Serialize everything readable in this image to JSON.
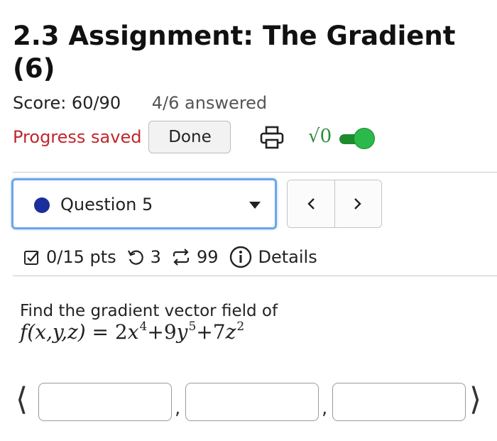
{
  "header": {
    "title": "2.3 Assignment: The Gradient (6)",
    "score": "Score: 60/90",
    "answered": "4/6 answered",
    "progress_status": "Progress saved",
    "done_label": "Done",
    "print_icon": "printer-icon",
    "math_toggle": {
      "icon": "sqrt-zero-icon",
      "glyph": "√0",
      "state": "on",
      "color": "#2ab94a"
    }
  },
  "question_nav": {
    "selected": "Question 5",
    "status_color": "#1a2f9c",
    "prev_label": "<",
    "next_label": ">"
  },
  "question_meta": {
    "points": "0/15 pts",
    "retries": "3",
    "attempts": "99",
    "details_label": "Details"
  },
  "problem": {
    "prompt": "Find the gradient vector field of",
    "formula": {
      "lhs": "f(x,y,z) = ",
      "terms": [
        {
          "coef": "2",
          "var": "x",
          "exp": "4",
          "op": "+"
        },
        {
          "coef": "9",
          "var": "y",
          "exp": "5",
          "op": "+"
        },
        {
          "coef": "7",
          "var": "z",
          "exp": "2",
          "op": ""
        }
      ]
    },
    "answer": {
      "open_bracket": "⟨",
      "close_bracket": "⟩",
      "separator": ",",
      "fields": [
        "",
        "",
        ""
      ]
    }
  }
}
